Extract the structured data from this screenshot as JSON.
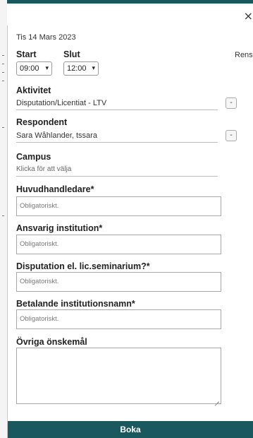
{
  "dialog": {
    "close_symbol": "×",
    "date": "Tis 14 Mars 2023",
    "rensa_label": "Rensa"
  },
  "time": {
    "start_label": "Start",
    "end_label": "Slut",
    "start_value": "09:00",
    "end_value": "12:00"
  },
  "activity": {
    "label": "Aktivitet",
    "value": "Disputation/Licentiat - LTV",
    "button": "-"
  },
  "respondent": {
    "label": "Respondent",
    "value": "Sara Wåhlander, tssara",
    "button": "-"
  },
  "campus": {
    "label": "Campus",
    "placeholder": "Klicka för att välja"
  },
  "fields": [
    {
      "label": "Huvudhandledare*",
      "placeholder": "Obligatoriskt."
    },
    {
      "label": "Ansvarig institution*",
      "placeholder": "Obligatoriskt."
    },
    {
      "label": "Disputation el. lic.seminarium?*",
      "placeholder": "Obligatoriskt."
    },
    {
      "label": "Betalande institutionsnamn*",
      "placeholder": "Obligatoriskt."
    }
  ],
  "other": {
    "label": "Övriga önskemål"
  },
  "submit": {
    "label": "Boka"
  },
  "colors": {
    "accent": "#19585c"
  },
  "icons": {
    "close": "close-icon",
    "dropdown": "chevron-down-icon",
    "resize": "resize-grip-icon"
  }
}
